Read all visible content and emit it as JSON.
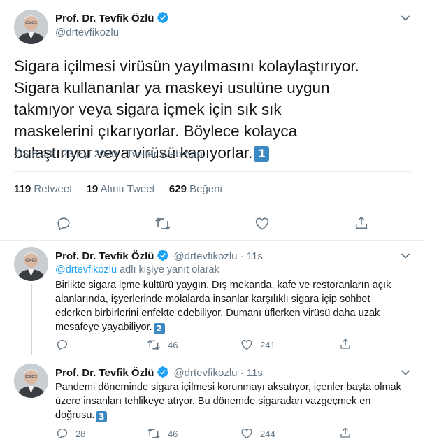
{
  "main_tweet": {
    "author_name": "Prof. Dr. Tevfik Özlü",
    "handle": "@drtevfikozlu",
    "text": "Sigara içilmesi virüsün yayılmasını kolaylaştırıyor. Sigara kullananlar ya maskeyi usulüne uygun takmıyor veya sigara içmek için sık sık maskelerini çıkarıyorlar. Böylece kolayca bulaştırıyor veya virüsü kapıyorlar.",
    "number_badge": "1",
    "meta": "ÖS 8:43 · 23 Eyl 2020 · Twitter Web App",
    "stats": [
      {
        "count": "119",
        "label": "Retweet"
      },
      {
        "count": "19",
        "label": "Alıntı Tweet"
      },
      {
        "count": "629",
        "label": "Beğeni"
      }
    ]
  },
  "replies": [
    {
      "author_name": "Prof. Dr. Tevfik Özlü",
      "handle": "@drtevfikozlu",
      "time": "11s",
      "replying_handle": "@drtevfikozlu",
      "replying_suffix": " adlı kişiye yanıt olarak",
      "text": "Birlikte sigara içme kültürü yaygın. Dış mekanda, kafe ve restoranların açık alanlarında, işyerlerinde molalarda insanlar karşılıklı sigara içip sohbet ederken birbirlerini enfekte edebiliyor. Dumanı üflerken virüsü daha uzak mesafeye yayabiliyor.",
      "number_badge": "2",
      "reply_count": "",
      "retweet_count": "46",
      "like_count": "241"
    },
    {
      "author_name": "Prof. Dr. Tevfik Özlü",
      "handle": "@drtevfikozlu",
      "time": "11s",
      "text": "Pandemi döneminde sigara içilmesi korunmayı aksatıyor, içenler başta olmak üzere insanları tehlikeye atıyor. Bu dönemde sigaradan vazgeçmek en doğrusu.",
      "number_badge": "3",
      "reply_count": "28",
      "retweet_count": "46",
      "like_count": "244"
    }
  ],
  "icons": {
    "verified": "verified-badge-icon",
    "caret": "chevron-down-icon",
    "reply": "reply-icon",
    "retweet": "retweet-icon",
    "like": "heart-icon",
    "share": "share-icon"
  },
  "colors": {
    "verified": "#1da1f2",
    "secondary_text": "#657786",
    "link": "#1da1f2",
    "number_badge": "#3b88c3",
    "divider": "#e6ecf0"
  }
}
